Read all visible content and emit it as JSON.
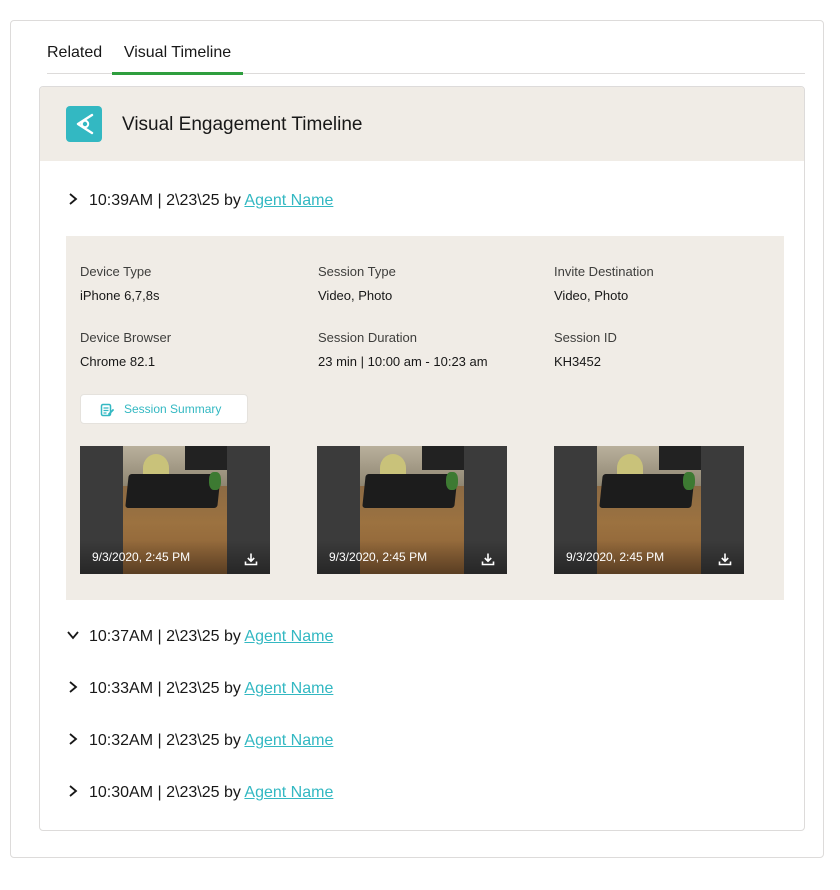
{
  "tabs": [
    {
      "label": "Related",
      "active": false
    },
    {
      "label": "Visual Timeline",
      "active": true
    }
  ],
  "card": {
    "title": "Visual Engagement Timeline",
    "icon": "eye-icon",
    "accent_color": "#33b8c2"
  },
  "entries": [
    {
      "time": "10:39AM",
      "date": "2\\23\\25",
      "by": "by",
      "agent": "Agent Name",
      "chevron": "chevron-right-icon"
    },
    {
      "time": "10:37AM",
      "date": "2\\23\\25",
      "by": "by",
      "agent": "Agent Name",
      "chevron": "chevron-down-icon"
    },
    {
      "time": "10:33AM",
      "date": "2\\23\\25",
      "by": "by",
      "agent": "Agent Name",
      "chevron": "chevron-right-icon"
    },
    {
      "time": "10:32AM",
      "date": "2\\23\\25",
      "by": "by",
      "agent": "Agent Name",
      "chevron": "chevron-right-icon"
    },
    {
      "time": "10:30AM",
      "date": "2\\23\\25",
      "by": "by",
      "agent": "Agent Name",
      "chevron": "chevron-right-icon"
    }
  ],
  "separator": "|",
  "details": {
    "device_type": {
      "label": "Device Type",
      "value": "iPhone 6,7,8s"
    },
    "session_type": {
      "label": "Session Type",
      "value": "Video, Photo"
    },
    "invite_destination": {
      "label": "Invite Destination",
      "value": "Video, Photo"
    },
    "device_browser": {
      "label": "Device Browser",
      "value": "Chrome 82.1"
    },
    "session_duration": {
      "label": "Session Duration",
      "value": "23 min | 10:00 am - 10:23 am"
    },
    "session_id": {
      "label": "Session ID",
      "value": "KH3452"
    },
    "summary_button": {
      "label": "Session Summary",
      "icon": "notes-icon"
    }
  },
  "thumbnails": [
    {
      "timestamp": "9/3/2020, 2:45 PM",
      "icon": "download-icon"
    },
    {
      "timestamp": "9/3/2020, 2:45 PM",
      "icon": "download-icon"
    },
    {
      "timestamp": "9/3/2020, 2:45 PM",
      "icon": "download-icon"
    }
  ]
}
